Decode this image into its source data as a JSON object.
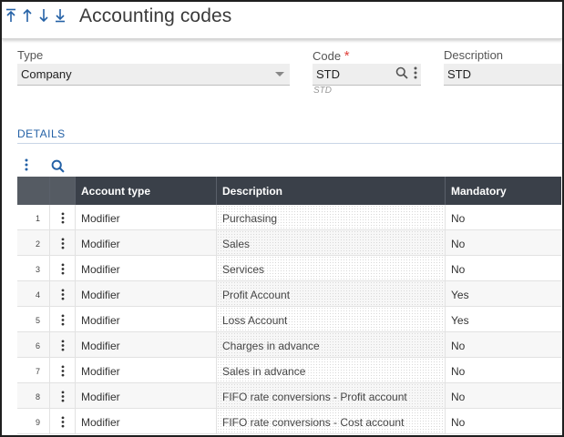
{
  "header": {
    "title": "Accounting codes",
    "nav": [
      {
        "name": "first-record-icon"
      },
      {
        "name": "previous-record-icon"
      },
      {
        "name": "next-record-icon"
      },
      {
        "name": "last-record-icon"
      }
    ]
  },
  "form": {
    "type": {
      "label": "Type",
      "value": "Company"
    },
    "code": {
      "label": "Code",
      "required_mark": "*",
      "value": "STD",
      "hint": "STD"
    },
    "description": {
      "label": "Description",
      "value": "STD"
    }
  },
  "details": {
    "title": "DETAILS",
    "columns": {
      "account_type": "Account type",
      "description": "Description",
      "mandatory": "Mandatory"
    },
    "rows": [
      {
        "num": "1",
        "account_type": "Modifier",
        "description": "Purchasing",
        "mandatory": "No"
      },
      {
        "num": "2",
        "account_type": "Modifier",
        "description": "Sales",
        "mandatory": "No"
      },
      {
        "num": "3",
        "account_type": "Modifier",
        "description": "Services",
        "mandatory": "No"
      },
      {
        "num": "4",
        "account_type": "Modifier",
        "description": "Profit Account",
        "mandatory": "Yes"
      },
      {
        "num": "5",
        "account_type": "Modifier",
        "description": "Loss Account",
        "mandatory": "Yes"
      },
      {
        "num": "6",
        "account_type": "Modifier",
        "description": "Charges in advance",
        "mandatory": "No"
      },
      {
        "num": "7",
        "account_type": "Modifier",
        "description": "Sales in advance",
        "mandatory": "No"
      },
      {
        "num": "8",
        "account_type": "Modifier",
        "description": "FIFO rate conversions - Profit account",
        "mandatory": "No"
      },
      {
        "num": "9",
        "account_type": "Modifier",
        "description": "FIFO rate conversions - Cost account",
        "mandatory": "No"
      }
    ]
  },
  "colors": {
    "accent": "#2461a6",
    "header_bg": "#3a4049",
    "required": "#e0413b"
  }
}
